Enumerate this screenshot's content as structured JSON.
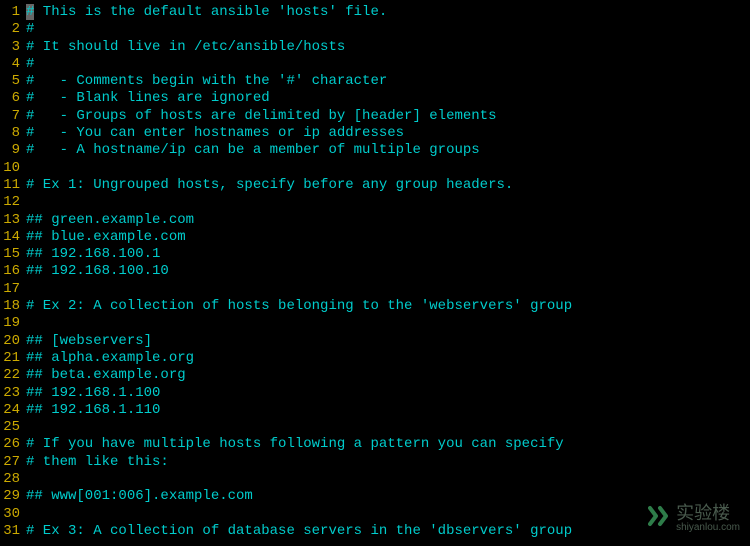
{
  "editor": {
    "lines": [
      {
        "num": "1",
        "text": "# This is the default ansible 'hosts' file.",
        "cursor": 0
      },
      {
        "num": "2",
        "text": "#"
      },
      {
        "num": "3",
        "text": "# It should live in /etc/ansible/hosts"
      },
      {
        "num": "4",
        "text": "#"
      },
      {
        "num": "5",
        "text": "#   - Comments begin with the '#' character"
      },
      {
        "num": "6",
        "text": "#   - Blank lines are ignored"
      },
      {
        "num": "7",
        "text": "#   - Groups of hosts are delimited by [header] elements"
      },
      {
        "num": "8",
        "text": "#   - You can enter hostnames or ip addresses"
      },
      {
        "num": "9",
        "text": "#   - A hostname/ip can be a member of multiple groups"
      },
      {
        "num": "10",
        "text": ""
      },
      {
        "num": "11",
        "text": "# Ex 1: Ungrouped hosts, specify before any group headers."
      },
      {
        "num": "12",
        "text": ""
      },
      {
        "num": "13",
        "text": "## green.example.com"
      },
      {
        "num": "14",
        "text": "## blue.example.com"
      },
      {
        "num": "15",
        "text": "## 192.168.100.1"
      },
      {
        "num": "16",
        "text": "## 192.168.100.10"
      },
      {
        "num": "17",
        "text": ""
      },
      {
        "num": "18",
        "text": "# Ex 2: A collection of hosts belonging to the 'webservers' group"
      },
      {
        "num": "19",
        "text": ""
      },
      {
        "num": "20",
        "text": "## [webservers]"
      },
      {
        "num": "21",
        "text": "## alpha.example.org"
      },
      {
        "num": "22",
        "text": "## beta.example.org"
      },
      {
        "num": "23",
        "text": "## 192.168.1.100"
      },
      {
        "num": "24",
        "text": "## 192.168.1.110"
      },
      {
        "num": "25",
        "text": ""
      },
      {
        "num": "26",
        "text": "# If you have multiple hosts following a pattern you can specify"
      },
      {
        "num": "27",
        "text": "# them like this:"
      },
      {
        "num": "28",
        "text": ""
      },
      {
        "num": "29",
        "text": "## www[001:006].example.com"
      },
      {
        "num": "30",
        "text": ""
      },
      {
        "num": "31",
        "text": "# Ex 3: A collection of database servers in the 'dbservers' group"
      }
    ]
  },
  "watermark": {
    "cn": "实验楼",
    "url": "shiyanlou.com"
  }
}
